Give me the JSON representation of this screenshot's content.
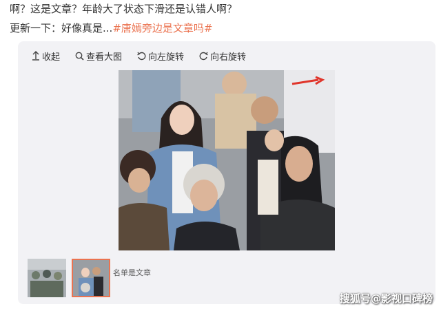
{
  "post": {
    "line1": "啊？这是文章？年龄大了状态下滑还是认错人啊？",
    "line2_prefix": "更新一下：好像真是...",
    "line2_hashtag": "#唐嫣旁边是文章吗#"
  },
  "toolbar": {
    "collapse_label": "收起",
    "view_large_label": "查看大图",
    "rotate_left_label": "向左旋转",
    "rotate_right_label": "向右旋转"
  },
  "thumbnails": {
    "caption": "名单是文章"
  },
  "watermark": {
    "text": "搜狐号@影视口碑榜"
  },
  "colors": {
    "hashtag": "#eb7350",
    "card_bg": "#f2f2f5",
    "thumb_selected_border": "#eb7350"
  }
}
